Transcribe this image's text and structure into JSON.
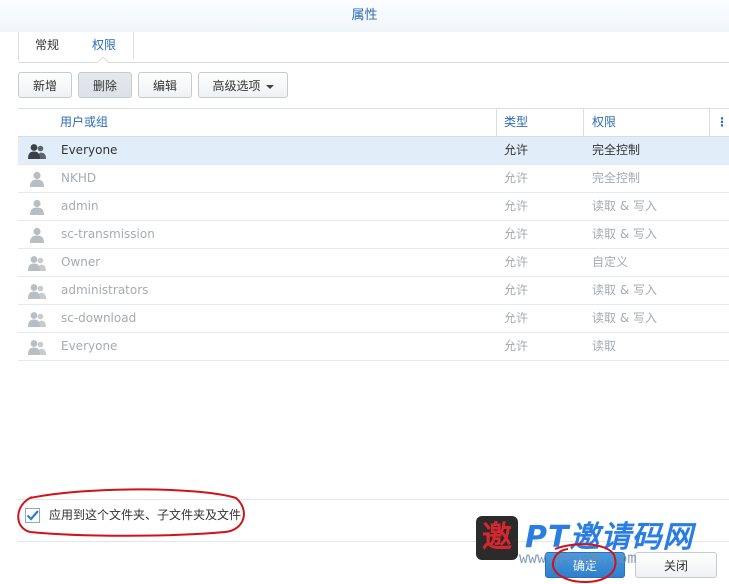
{
  "dialog": {
    "title": "属性"
  },
  "tabs": [
    {
      "label": "常规"
    },
    {
      "label": "权限"
    }
  ],
  "toolbar": {
    "add_label": "新增",
    "delete_label": "删除",
    "edit_label": "编辑",
    "advanced_label": "高级选项"
  },
  "table": {
    "headers": {
      "user": "用户或组",
      "type": "类型",
      "permission": "权限"
    },
    "rows": [
      {
        "name": "Everyone",
        "type": "允许",
        "permission": "完全控制",
        "icon": "group-icon",
        "selected": true
      },
      {
        "name": "NKHD",
        "type": "允许",
        "permission": "完全控制",
        "icon": "user-icon"
      },
      {
        "name": "admin",
        "type": "允许",
        "permission": "读取 & 写入",
        "icon": "user-icon"
      },
      {
        "name": "sc-transmission",
        "type": "允许",
        "permission": "读取 & 写入",
        "icon": "user-icon"
      },
      {
        "name": "Owner",
        "type": "允许",
        "permission": "自定义",
        "icon": "group-icon"
      },
      {
        "name": "administrators",
        "type": "允许",
        "permission": "读取 & 写入",
        "icon": "group-icon"
      },
      {
        "name": "sc-download",
        "type": "允许",
        "permission": "读取 & 写入",
        "icon": "group-icon"
      },
      {
        "name": "Everyone",
        "type": "允许",
        "permission": "读取",
        "icon": "group-icon"
      }
    ]
  },
  "footer": {
    "apply_checked": true,
    "apply_label": "应用到这个文件夹、子文件夹及文件",
    "ok_label": "确定",
    "close_label": "关闭"
  },
  "watermark": {
    "brand": "PT邀请码网",
    "url": "www.ptyqm.com",
    "seal": "邀"
  },
  "colors": {
    "accent": "#2d6bb5",
    "selected_row": "#e1eefa",
    "annotation": "#d0121b",
    "primary_button": "#3a8ad6"
  }
}
